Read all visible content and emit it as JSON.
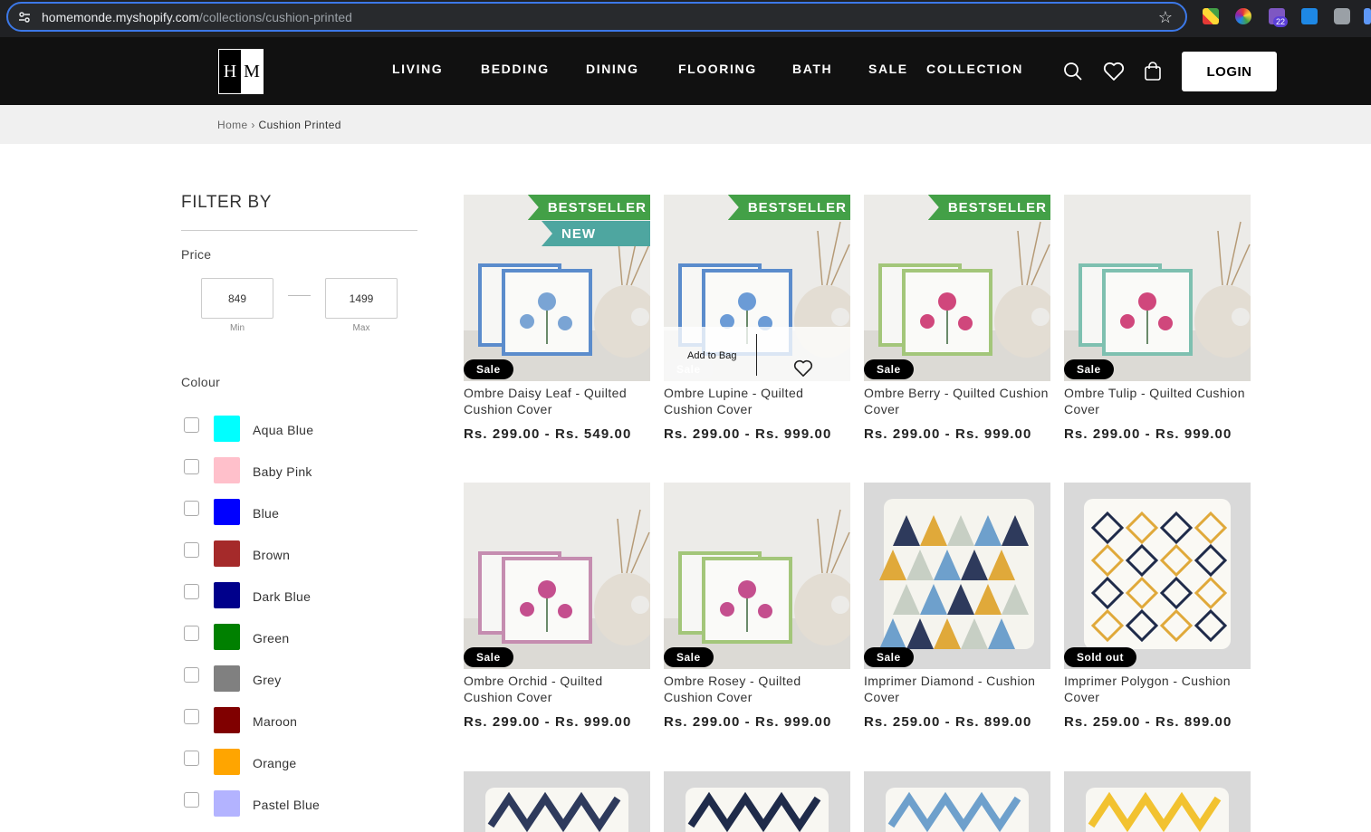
{
  "browser": {
    "url_host": "homemonde.myshopify.com",
    "url_path": "/collections/cushion-printed",
    "ext_badge": "22"
  },
  "header": {
    "logo": {
      "left": "H",
      "right": "M"
    },
    "nav": [
      "LIVING",
      "BEDDING",
      "DINING",
      "FLOORING",
      "BATH",
      "SALE",
      "COLLECTION"
    ],
    "login": "LOGIN"
  },
  "breadcrumb": {
    "home": "Home",
    "sep": "›",
    "current": "Cushion Printed"
  },
  "filter": {
    "title": "FILTER BY",
    "price_label": "Price",
    "min_value": "849",
    "max_value": "1499",
    "min_label": "Min",
    "max_label": "Max",
    "colour_label": "Colour",
    "colours": [
      {
        "name": "Aqua Blue",
        "hex": "#00ffff"
      },
      {
        "name": "Baby Pink",
        "hex": "#ffc0cb"
      },
      {
        "name": "Blue",
        "hex": "#0000ff"
      },
      {
        "name": "Brown",
        "hex": "#a52a2a"
      },
      {
        "name": "Dark Blue",
        "hex": "#00008b"
      },
      {
        "name": "Green",
        "hex": "#008000"
      },
      {
        "name": "Grey",
        "hex": "#808080"
      },
      {
        "name": "Maroon",
        "hex": "#800000"
      },
      {
        "name": "Orange",
        "hex": "#ffa500"
      },
      {
        "name": "Pastel Blue",
        "hex": "#b3b3ff"
      }
    ]
  },
  "products": [
    {
      "name": "Ombre Daisy Leaf - Quilted Cushion Cover",
      "price": "Rs. 299.00 - Rs. 549.00",
      "badge": "Sale",
      "ribbons": [
        "BESTSELLER",
        "NEW"
      ]
    },
    {
      "name": "Ombre Lupine - Quilted Cushion Cover",
      "price": "Rs. 299.00 - Rs. 999.00",
      "badge": "Sale",
      "ribbons": [
        "BESTSELLER"
      ],
      "hover": {
        "add": "Add to Bag"
      }
    },
    {
      "name": "Ombre Berry - Quilted Cushion Cover",
      "price": "Rs. 299.00 - Rs. 999.00",
      "badge": "Sale",
      "ribbons": [
        "BESTSELLER"
      ]
    },
    {
      "name": "Ombre Tulip - Quilted Cushion Cover",
      "price": "Rs. 299.00 - Rs. 999.00",
      "badge": "Sale",
      "ribbons": []
    },
    {
      "name": "Ombre Orchid - Quilted Cushion Cover",
      "price": "Rs. 299.00 - Rs. 999.00",
      "badge": "Sale",
      "ribbons": []
    },
    {
      "name": "Ombre Rosey - Quilted Cushion Cover",
      "price": "Rs. 299.00 - Rs. 999.00",
      "badge": "Sale",
      "ribbons": []
    },
    {
      "name": "Imprimer Diamond - Cushion Cover",
      "price": "Rs. 259.00 - Rs. 899.00",
      "badge": "Sale",
      "ribbons": []
    },
    {
      "name": "Imprimer Polygon - Cushion Cover",
      "price": "Rs. 259.00 - Rs. 899.00",
      "badge": "Sold out",
      "ribbons": []
    }
  ]
}
